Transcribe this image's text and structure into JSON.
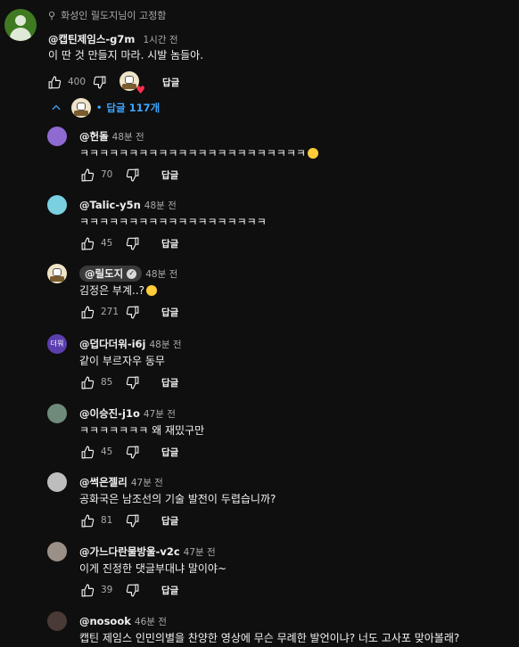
{
  "pinned": {
    "label": "화성인 릴도지님이 고정함",
    "icon": "pin-icon"
  },
  "main_comment": {
    "author": "@캡틴제임스-g7m",
    "time": "1시간 전",
    "text": "이 딴 것 만들지 마라. 시발 놈들아.",
    "likes": "400",
    "reply_label": "답글"
  },
  "replies_toggle": {
    "label": "답글 117개",
    "dot": "•"
  },
  "replies": [
    {
      "author": "@헌돌",
      "time": "48분 전",
      "text": "ㅋㅋㅋㅋㅋㅋㅋㅋㅋㅋㅋㅋㅋㅋㅋㅋㅋㅋㅋㅋㅋㅋㅋ",
      "likes": "70",
      "reply_label": "답글",
      "avatar_color": "#8e6ad1"
    },
    {
      "author": "@Talic-y5n",
      "time": "48분 전",
      "text": "ㅋㅋㅋㅋㅋㅋㅋㅋㅋㅋㅋㅋㅋㅋㅋㅋㅋㅋㅋ",
      "likes": "45",
      "reply_label": "답글",
      "avatar_color": "#7ad0e0"
    },
    {
      "author": "@릴도지",
      "time": "48분 전",
      "text": "김정은 부계..?",
      "likes": "271",
      "reply_label": "답글",
      "avatar_color": "#f0e4c8"
    },
    {
      "author": "@덥다더워-i6j",
      "time": "48분 전",
      "text": "같이 부르자우 동무",
      "likes": "85",
      "reply_label": "답글",
      "avatar_color": "#5b3fb0",
      "avatar_text": "더워"
    },
    {
      "author": "@이승진-j1o",
      "time": "47분 전",
      "text": "ㅋㅋㅋㅋㅋㅋㅋ 왜 재밌구만",
      "likes": "45",
      "reply_label": "답글",
      "avatar_color": "#6f8a7a"
    },
    {
      "author": "@썩은젤리",
      "time": "47분 전",
      "text": "공화국은 남조선의 기술 발전이 두렵습니까?",
      "likes": "81",
      "reply_label": "답글",
      "avatar_color": "#bdbdbd"
    },
    {
      "author": "@가느다란물방울-v2c",
      "time": "47분 전",
      "text": "이게 진정한 댓글부대냐 말이야~",
      "likes": "39",
      "reply_label": "답글",
      "avatar_color": "#9a9088"
    },
    {
      "author": "@nosook",
      "time": "46분 전",
      "text": "캡틴 제임스 인민의별을 찬양한 영상에 무슨 무례한 발언이냐? 너도 고사포 맞아볼래?",
      "likes": "",
      "reply_label": "",
      "avatar_color": "#4a3a36"
    }
  ],
  "icons": {
    "like": "thumbs-up-icon",
    "dislike": "thumbs-down-icon",
    "heart": "heart-icon",
    "chevron": "chevron-up-icon",
    "check": "check-icon"
  }
}
